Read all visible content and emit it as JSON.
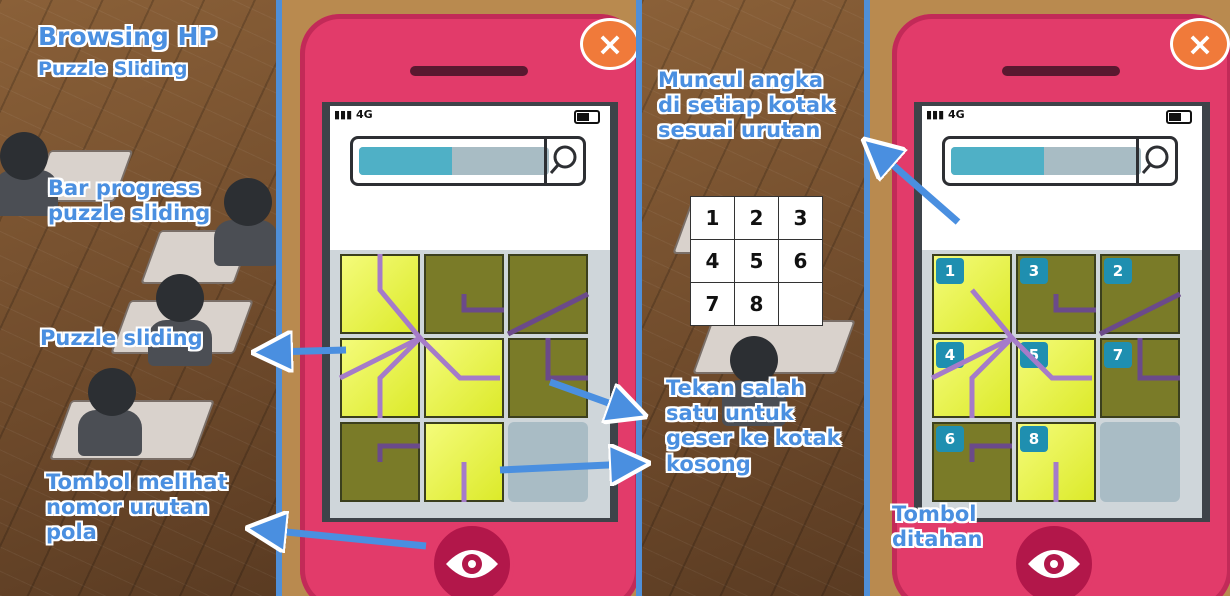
{
  "left_panel": {
    "title": "Browsing HP",
    "subtitle": "Puzzle Sliding",
    "callout_progress": "Bar progress\npuzzle sliding",
    "callout_puzzle": "Puzzle sliding",
    "callout_button": "Tombol melihat\nnomor urutan\npola"
  },
  "middle_panel": {
    "callout_numbers": "Muncul angka\ndi setiap  kotak\nsesuai urutan",
    "callout_tap": "Tekan salah\nsatu untuk\ngeser ke kotak\nkosong",
    "sequence": [
      [
        "1",
        "2",
        "3"
      ],
      [
        "4",
        "5",
        "6"
      ],
      [
        "7",
        "8",
        ""
      ]
    ]
  },
  "right_panel": {
    "callout_hold": "Tombol\nditahan"
  },
  "phone_left": {
    "signal": "4G",
    "progress_fraction": 0.49,
    "close_icon": "×"
  },
  "phone_right": {
    "signal": "4G",
    "progress_fraction": 0.49,
    "close_icon": "×",
    "tile_numbers": [
      "1",
      "3",
      "2",
      "4",
      "5",
      "7",
      "6",
      "8"
    ]
  },
  "colors": {
    "callout_text": "#4a8fe0",
    "phone_body": "#e23b6a",
    "progress_fill": "#4fb0c6",
    "tile_light": "#dcea2a",
    "tile_dark": "#7a7b28",
    "badge": "#1f8fb0",
    "close_button": "#f07a3a"
  },
  "icons": {
    "search": "search-icon",
    "close": "close-icon",
    "eye": "eye-icon",
    "battery": "battery-icon",
    "signal": "signal-icon"
  }
}
